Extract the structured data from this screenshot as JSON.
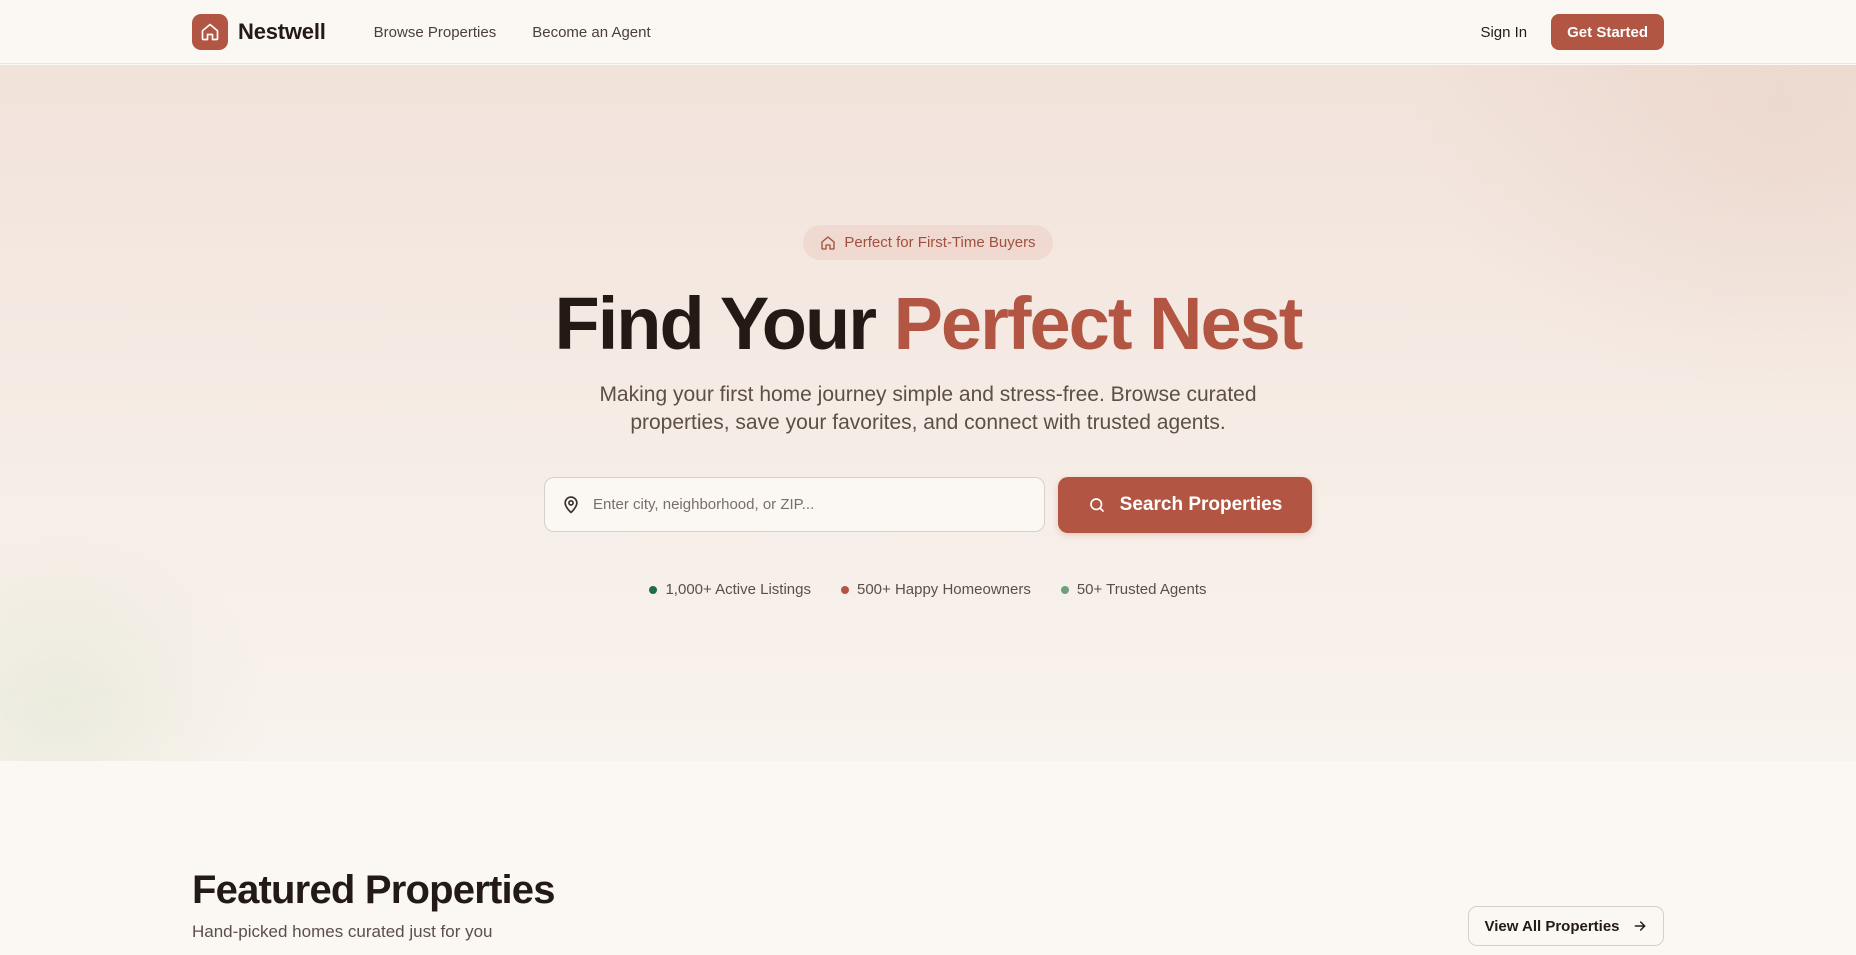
{
  "brand": {
    "name": "Nestwell",
    "icon": "home-icon",
    "accent_color": "#b25543"
  },
  "nav": {
    "links": [
      {
        "label": "Browse Properties"
      },
      {
        "label": "Become an Agent"
      }
    ],
    "sign_in": "Sign In",
    "get_started": "Get Started"
  },
  "hero": {
    "badge_icon": "home-icon",
    "badge_text": "Perfect for First-Time Buyers",
    "title_plain": "Find Your",
    "title_accent": "Perfect Nest",
    "subtitle": "Making your first home journey simple and stress-free. Browse curated properties, save your favorites, and connect with trusted agents.",
    "search": {
      "icon": "map-pin-icon",
      "placeholder": "Enter city, neighborhood, or ZIP...",
      "value": "",
      "button_icon": "search-icon",
      "button_label": "Search Properties"
    },
    "stats": [
      {
        "label": "1,000+ Active Listings",
        "color": "#1f6b4a"
      },
      {
        "label": "500+ Happy Homeowners",
        "color": "#b25543"
      },
      {
        "label": "50+ Trusted Agents",
        "color": "#6fa07a"
      }
    ]
  },
  "featured": {
    "title": "Featured Properties",
    "subtitle": "Hand-picked homes curated just for you",
    "view_all": "View All Properties",
    "view_all_icon": "arrow-right-icon"
  }
}
